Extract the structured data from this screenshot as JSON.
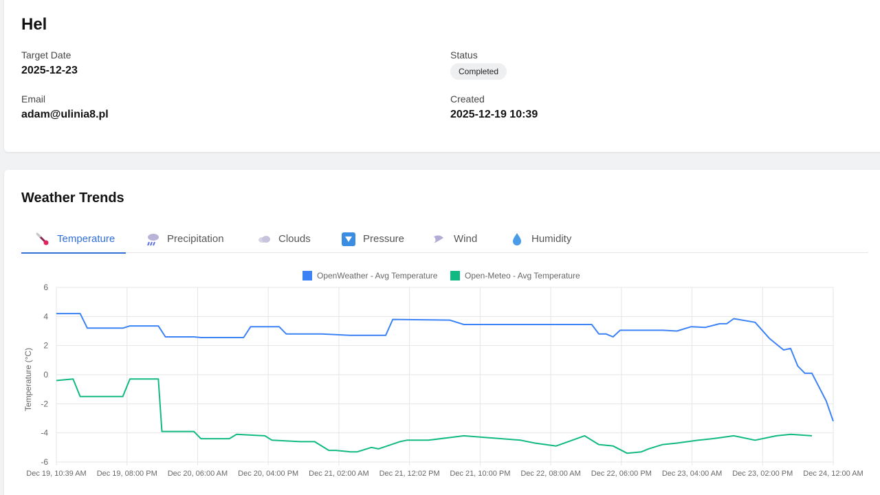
{
  "record": {
    "title": "Hel",
    "target_date_label": "Target Date",
    "target_date": "2025-12-23",
    "status_label": "Status",
    "status": "Completed",
    "email_label": "Email",
    "email": "adam@ulinia8.pl",
    "created_label": "Created",
    "created": "2025-12-19 10:39"
  },
  "trends": {
    "title": "Weather Trends",
    "tabs": [
      {
        "label": "Temperature",
        "icon": "thermometer-icon",
        "active": true
      },
      {
        "label": "Precipitation",
        "icon": "rain-cloud-icon",
        "active": false
      },
      {
        "label": "Clouds",
        "icon": "cloud-icon",
        "active": false
      },
      {
        "label": "Pressure",
        "icon": "pressure-icon",
        "active": false
      },
      {
        "label": "Wind",
        "icon": "wind-icon",
        "active": false
      },
      {
        "label": "Humidity",
        "icon": "droplet-icon",
        "active": false
      }
    ]
  },
  "colors": {
    "accent": "#2f6fd6",
    "series_openweather": "#3b82f6",
    "series_openmeteo": "#10b981"
  },
  "chart_data": {
    "type": "line",
    "ylabel": "Temperature (°C)",
    "ylim": [
      -6,
      6
    ],
    "yticks": [
      6,
      4,
      2,
      0,
      -2,
      -4,
      -6
    ],
    "xlim": [
      "2025-12-19 10:39",
      "2025-12-24 00:00"
    ],
    "xticks": [
      "Dec 19, 10:39 AM",
      "Dec 19, 08:00 PM",
      "Dec 20, 06:00 AM",
      "Dec 20, 04:00 PM",
      "Dec 21, 02:00 AM",
      "Dec 21, 12:02 PM",
      "Dec 21, 10:00 PM",
      "Dec 22, 08:00 AM",
      "Dec 22, 06:00 PM",
      "Dec 23, 04:00 AM",
      "Dec 23, 02:00 PM",
      "Dec 24, 12:00 AM"
    ],
    "legend_position": "top",
    "grid": true,
    "series": [
      {
        "name": "OpenWeather - Avg Temperature",
        "x": [
          "2025-12-19 10:39",
          "2025-12-19 14:00",
          "2025-12-19 15:00",
          "2025-12-19 20:00",
          "2025-12-19 21:00",
          "2025-12-20 01:00",
          "2025-12-20 02:00",
          "2025-12-20 06:00",
          "2025-12-20 07:00",
          "2025-12-20 13:00",
          "2025-12-20 14:00",
          "2025-12-20 18:00",
          "2025-12-20 19:00",
          "2025-12-20 23:00",
          "2025-12-21 00:00",
          "2025-12-21 04:00",
          "2025-12-21 09:00",
          "2025-12-21 10:00",
          "2025-12-21 18:00",
          "2025-12-21 20:00",
          "2025-12-22 10:00",
          "2025-12-22 14:00",
          "2025-12-22 15:00",
          "2025-12-22 16:00",
          "2025-12-22 17:00",
          "2025-12-22 18:00",
          "2025-12-23 00:00",
          "2025-12-23 02:00",
          "2025-12-23 04:00",
          "2025-12-23 06:00",
          "2025-12-23 08:00",
          "2025-12-23 09:00",
          "2025-12-23 10:00",
          "2025-12-23 13:00",
          "2025-12-23 15:00",
          "2025-12-23 17:00",
          "2025-12-23 18:00",
          "2025-12-23 19:00",
          "2025-12-23 20:00",
          "2025-12-23 21:00",
          "2025-12-23 23:00",
          "2025-12-24 00:00"
        ],
        "values": [
          4.2,
          4.2,
          3.2,
          3.2,
          3.35,
          3.35,
          2.6,
          2.6,
          2.55,
          2.55,
          3.3,
          3.3,
          2.8,
          2.8,
          2.8,
          2.7,
          2.7,
          3.8,
          3.75,
          3.45,
          3.45,
          3.45,
          2.8,
          2.8,
          2.6,
          3.05,
          3.05,
          3.0,
          3.3,
          3.25,
          3.5,
          3.5,
          3.85,
          3.6,
          2.5,
          1.7,
          1.8,
          0.6,
          0.1,
          0.1,
          -1.8,
          -3.2
        ]
      },
      {
        "name": "Open-Meteo - Avg Temperature",
        "x": [
          "2025-12-19 10:39",
          "2025-12-19 13:00",
          "2025-12-19 14:00",
          "2025-12-19 20:00",
          "2025-12-19 21:00",
          "2025-12-20 00:00",
          "2025-12-20 01:00",
          "2025-12-20 01:30",
          "2025-12-20 06:00",
          "2025-12-20 07:00",
          "2025-12-20 11:00",
          "2025-12-20 12:00",
          "2025-12-20 16:00",
          "2025-12-20 17:00",
          "2025-12-20 21:00",
          "2025-12-20 23:00",
          "2025-12-21 01:00",
          "2025-12-21 02:00",
          "2025-12-21 04:00",
          "2025-12-21 05:00",
          "2025-12-21 07:00",
          "2025-12-21 08:00",
          "2025-12-21 11:00",
          "2025-12-21 12:00",
          "2025-12-21 14:00",
          "2025-12-21 15:00",
          "2025-12-21 20:00",
          "2025-12-22 04:00",
          "2025-12-22 06:00",
          "2025-12-22 09:00",
          "2025-12-22 13:00",
          "2025-12-22 15:00",
          "2025-12-22 17:00",
          "2025-12-22 19:00",
          "2025-12-22 21:00",
          "2025-12-22 22:00",
          "2025-12-23 00:00",
          "2025-12-23 02:00",
          "2025-12-23 05:00",
          "2025-12-23 07:00",
          "2025-12-23 10:00",
          "2025-12-23 11:00",
          "2025-12-23 13:00",
          "2025-12-23 15:00",
          "2025-12-23 16:00",
          "2025-12-23 18:00",
          "2025-12-23 21:00"
        ],
        "values": [
          -0.4,
          -0.3,
          -1.5,
          -1.5,
          -0.3,
          -0.3,
          -0.3,
          -3.9,
          -3.9,
          -4.4,
          -4.4,
          -4.1,
          -4.2,
          -4.5,
          -4.6,
          -4.6,
          -5.2,
          -5.2,
          -5.3,
          -5.3,
          -5.0,
          -5.1,
          -4.6,
          -4.5,
          -4.5,
          -4.5,
          -4.2,
          -4.5,
          -4.7,
          -4.9,
          -4.2,
          -4.8,
          -4.9,
          -5.4,
          -5.3,
          -5.1,
          -4.8,
          -4.7,
          -4.5,
          -4.4,
          -4.2,
          -4.3,
          -4.5,
          -4.3,
          -4.2,
          -4.1,
          -4.2
        ]
      }
    ]
  }
}
